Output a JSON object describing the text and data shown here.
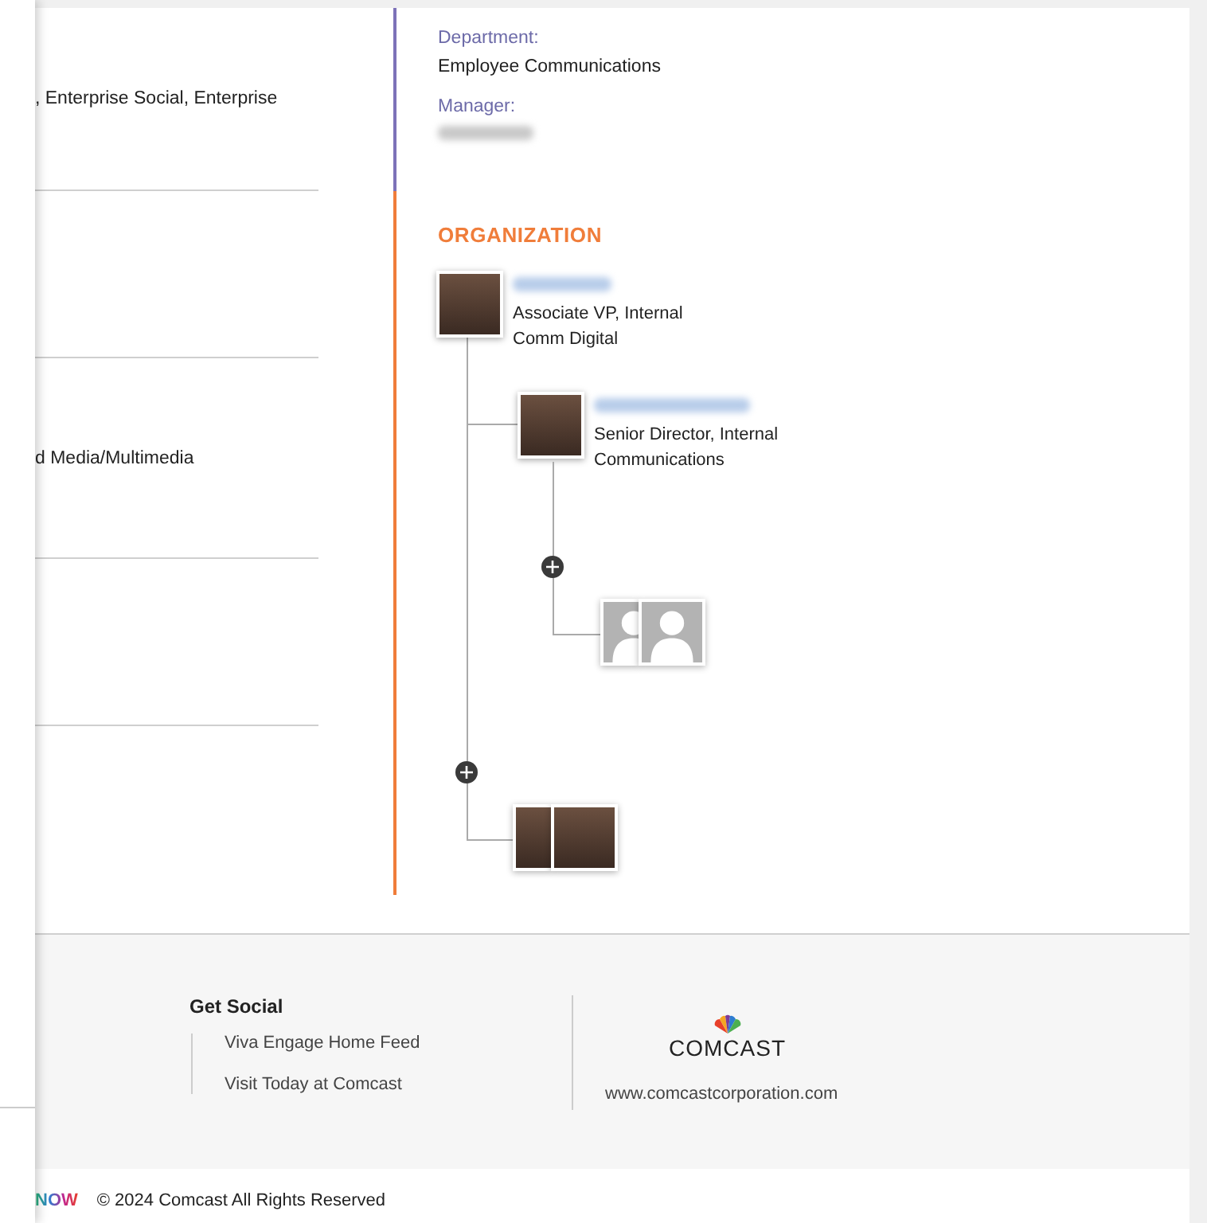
{
  "left_fields": [
    {
      "value": ", Enterprise Social, Enterprise"
    },
    {
      "value": "d Media/Multimedia"
    }
  ],
  "details": [
    {
      "label": "Department:",
      "value": "Employee Communications",
      "blurred": false
    },
    {
      "label": "Manager:",
      "blurred": true
    }
  ],
  "organization": {
    "heading": "ORGANIZATION",
    "root": {
      "name_blurred": true,
      "title": "Associate VP, Internal\nComm Digital",
      "kind": "person"
    },
    "report": {
      "name_blurred": true,
      "title": "Senior Director, Internal\nCommunications",
      "kind": "person"
    },
    "groups": [
      {
        "expanded": false,
        "photos": [
          {
            "kind": "silhouette"
          },
          {
            "kind": "silhouette"
          }
        ]
      },
      {
        "expanded": false,
        "photos": [
          {
            "kind": "person"
          },
          {
            "kind": "person"
          }
        ]
      }
    ]
  },
  "footer": {
    "social_heading": "Get Social",
    "links": [
      "Viva Engage Home Feed",
      "Visit Today at Comcast"
    ],
    "logo_text": "COMCAST",
    "url": "www.comcastcorporation.com"
  },
  "bottom_bar": {
    "logo_text": "NOW",
    "copyright": "© 2024 Comcast All Rights Reserved"
  }
}
